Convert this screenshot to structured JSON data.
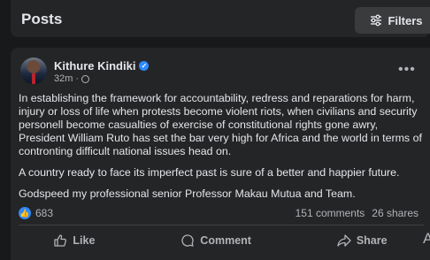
{
  "header": {
    "title": "Posts",
    "filters_label": "Filters"
  },
  "post": {
    "author": "Kithure Kindiki",
    "time": "32m",
    "paragraphs": [
      "In establishing the framework for accountability, redress and reparations for harm, injury or loss of life when protests become violent riots, when civilians and security personell become casualties of exercise of constitutional rights gone awry, President William Ruto has set the bar very high for Africa and the world in terms of contronting difficult national issues head on.",
      "A country ready to face its imperfect past is sure of a  better and happier future.",
      "Godspeed my professional senior  Professor Makau Mutua and Team."
    ],
    "reaction_count": "683",
    "comments": "151 comments",
    "shares": "26 shares"
  },
  "actions": {
    "like": "Like",
    "comment": "Comment",
    "share": "Share",
    "overflow_text": "Ac"
  },
  "icons": {
    "filters": "sliders-icon",
    "verified": "verified-badge-icon",
    "privacy": "globe-icon",
    "more": "more-options-icon",
    "reaction": "thumbs-up-icon"
  },
  "colors": {
    "background": "#18191a",
    "card": "#242526",
    "accent": "#2d88ff",
    "secondary_text": "#b0b3b8"
  }
}
